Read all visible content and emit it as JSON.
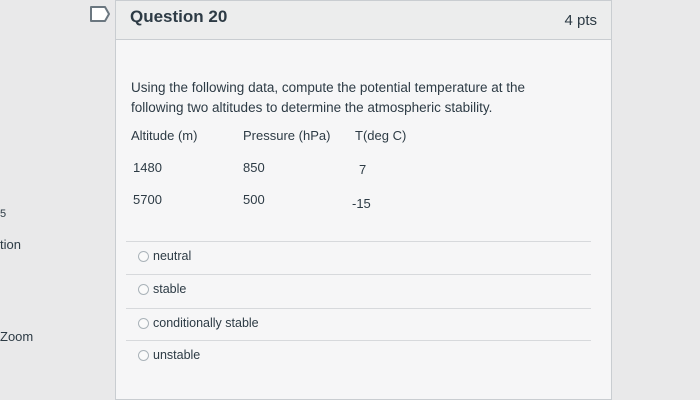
{
  "sidebar": {
    "mark": "5",
    "question_label": "tion",
    "zoom_label": "Zoom"
  },
  "question": {
    "title": "Question 20",
    "points": "4 pts",
    "text": "Using the following data, compute the potential temperature at the following two altitudes to determine the atmospheric stability."
  },
  "table": {
    "headers": [
      "Altitude (m)",
      "Pressure (hPa)",
      "T(deg C)"
    ],
    "rows": [
      [
        "1480",
        "850",
        "7"
      ],
      [
        "5700",
        "500",
        "-15"
      ]
    ]
  },
  "answers": [
    {
      "label": "neutral"
    },
    {
      "label": "stable"
    },
    {
      "label": "conditionally stable"
    },
    {
      "label": "unstable"
    }
  ]
}
